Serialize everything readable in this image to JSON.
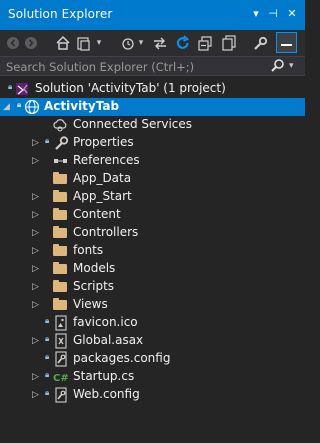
{
  "panel": {
    "title": "Solution Explorer",
    "pin_glyph": "⊣",
    "close_glyph": "✕",
    "menu_glyph": "▾"
  },
  "search": {
    "placeholder": "Search Solution Explorer (Ctrl+;)"
  },
  "colors": {
    "accent": "#007acc",
    "background": "#252526",
    "folder": "#dcb67a",
    "text": "#f1f1f1"
  },
  "tree": {
    "solution": "Solution 'ActivityTab' (1 project)",
    "project": "ActivityTab",
    "items": [
      {
        "label": "Connected Services",
        "icon": "connected-services-icon"
      },
      {
        "label": "Properties",
        "icon": "wrench-icon"
      },
      {
        "label": "References",
        "icon": "references-icon"
      },
      {
        "label": "App_Data",
        "icon": "folder-icon"
      },
      {
        "label": "App_Start",
        "icon": "folder-icon"
      },
      {
        "label": "Content",
        "icon": "folder-icon"
      },
      {
        "label": "Controllers",
        "icon": "folder-icon"
      },
      {
        "label": "fonts",
        "icon": "folder-icon"
      },
      {
        "label": "Models",
        "icon": "folder-icon"
      },
      {
        "label": "Scripts",
        "icon": "folder-icon"
      },
      {
        "label": "Views",
        "icon": "folder-icon"
      },
      {
        "label": "favicon.ico",
        "icon": "image-file-icon"
      },
      {
        "label": "Global.asax",
        "icon": "asax-file-icon"
      },
      {
        "label": "packages.config",
        "icon": "config-file-icon"
      },
      {
        "label": "Startup.cs",
        "icon": "csharp-file-icon"
      },
      {
        "label": "Web.config",
        "icon": "config-file-icon"
      }
    ]
  }
}
